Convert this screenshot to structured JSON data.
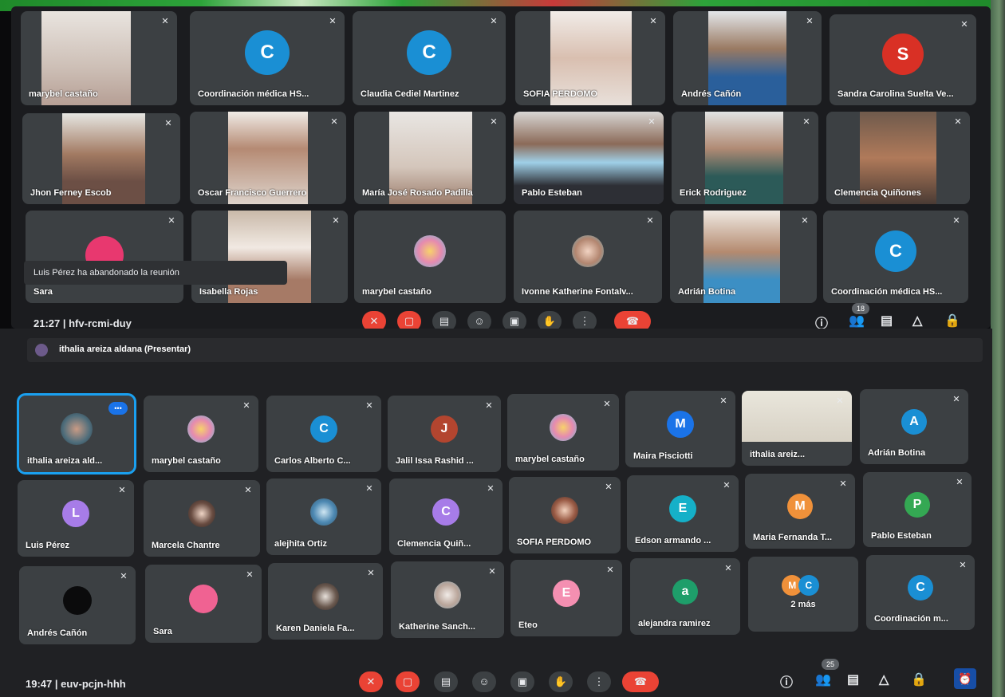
{
  "screen_top": {
    "tiles": [
      {
        "name": "marybel castaño"
      },
      {
        "name": "Coordinación médica HS...",
        "initial": "C"
      },
      {
        "name": "Claudia Cediel Martinez",
        "initial": "C"
      },
      {
        "name": "SOFIA PERDOMO"
      },
      {
        "name": "Andrés Cañón"
      },
      {
        "name": "Sandra Carolina Suelta Ve...",
        "initial": "S"
      },
      {
        "name": "Jhon Ferney Escob"
      },
      {
        "name": "Oscar Francisco Guerrero"
      },
      {
        "name": "María José Rosado Padilla"
      },
      {
        "name": "Pablo Esteban"
      },
      {
        "name": "Erick Rodriguez"
      },
      {
        "name": "Clemencia Quiñones"
      },
      {
        "name": "Sara"
      },
      {
        "name": "Isabella Rojas"
      },
      {
        "name": "marybel castaño"
      },
      {
        "name": "Ivonne Katherine Fontalv..."
      },
      {
        "name": "Adrián Botina"
      },
      {
        "name": "Coordinación médica HS...",
        "initial": "C"
      }
    ],
    "toast": "Luis Pérez ha abandonado la reunión",
    "time_code": "21:27  |  hfv-rcmi-duy",
    "participants_badge": "18"
  },
  "screen_bottom": {
    "presenting": "ithalia areiza aldana (Presentar)",
    "tiles": [
      {
        "name": "ithalia areiza ald..."
      },
      {
        "name": "marybel castaño"
      },
      {
        "name": "Carlos Alberto C...",
        "initial": "C"
      },
      {
        "name": "Jalil Issa Rashid ...",
        "initial": "J"
      },
      {
        "name": "marybel castaño"
      },
      {
        "name": "Maira Pisciotti",
        "initial": "M"
      },
      {
        "name": "ithalia areiz..."
      },
      {
        "name": "Adrián Botina",
        "initial": "A"
      },
      {
        "name": "Luis Pérez",
        "initial": "L"
      },
      {
        "name": "Marcela Chantre"
      },
      {
        "name": "alejhita Ortiz"
      },
      {
        "name": "Clemencia Quiñ...",
        "initial": "C"
      },
      {
        "name": "SOFIA PERDOMO"
      },
      {
        "name": "Edson armando ...",
        "initial": "E"
      },
      {
        "name": "Maria Fernanda T...",
        "initial": "M"
      },
      {
        "name": "Pablo Esteban",
        "initial": "P"
      },
      {
        "name": "Andrés Cañón"
      },
      {
        "name": "Sara"
      },
      {
        "name": "Karen Daniela Fa..."
      },
      {
        "name": "Katherine Sanch..."
      },
      {
        "name": "Eteo",
        "initial": "E"
      },
      {
        "name": "alejandra ramirez",
        "initial": "a"
      },
      {
        "name": "2 más",
        "initials": [
          "M",
          "C"
        ]
      },
      {
        "name": "Coordinación m...",
        "initial": "C"
      }
    ],
    "time_code": "19:47  |  euv-pcjn-hhh",
    "participants_badge": "25"
  },
  "colors": {
    "tile_bg": "#3c4043",
    "end_call": "#ea4335",
    "accent": "#1a73e8"
  }
}
